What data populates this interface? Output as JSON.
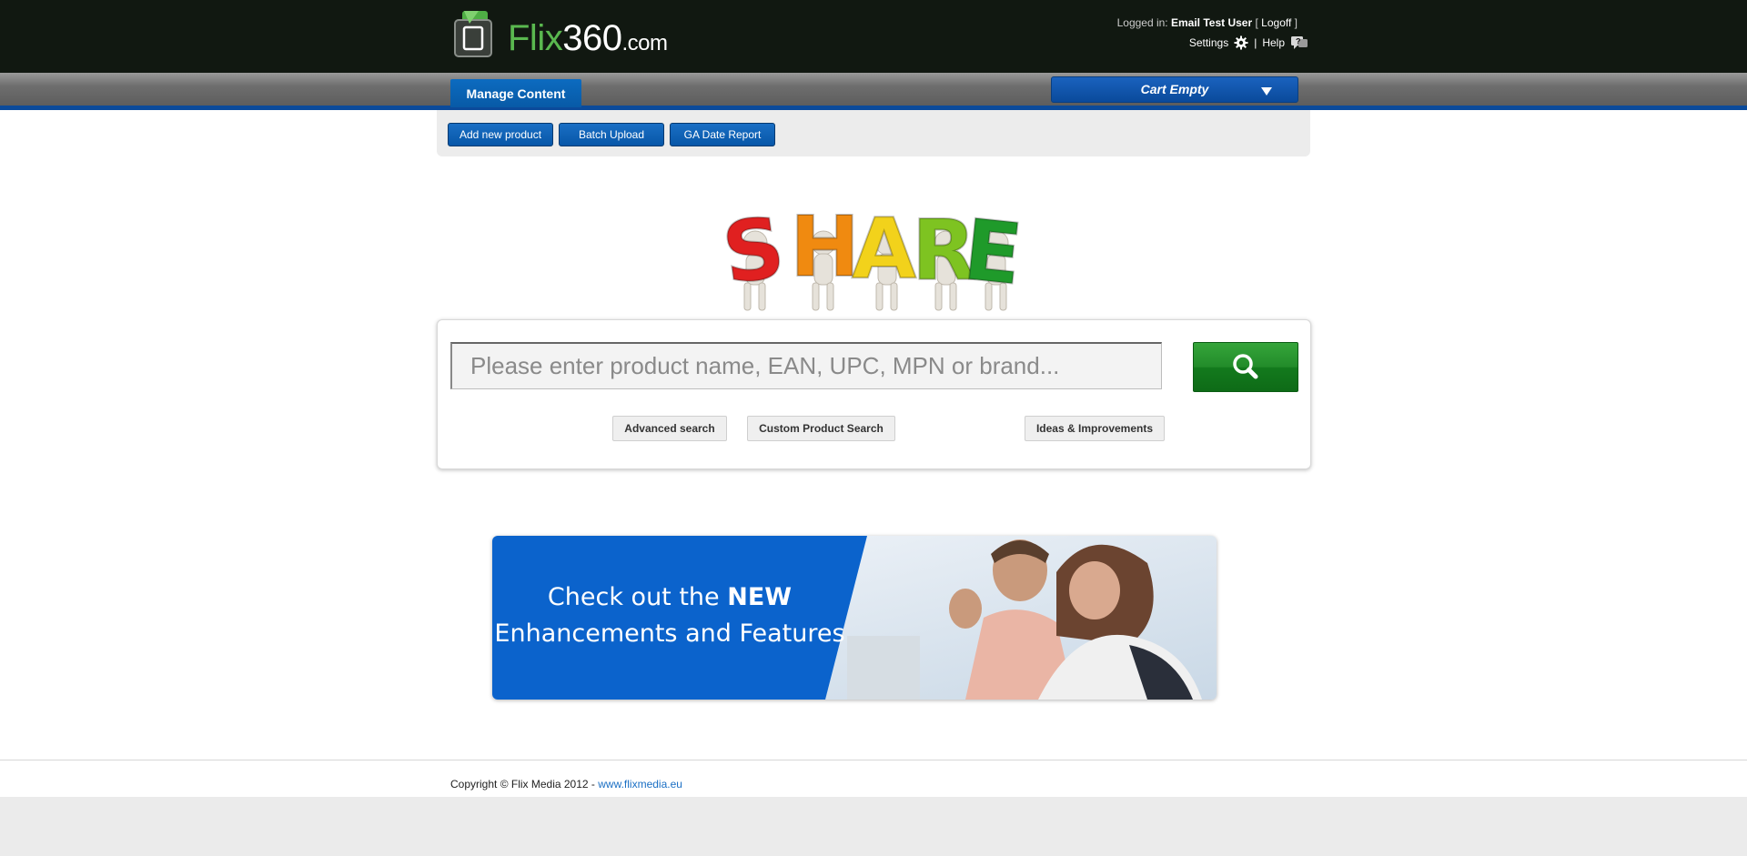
{
  "brand": {
    "logo_flix": "Flix",
    "logo_num": "360",
    "logo_com": ".com"
  },
  "header": {
    "logged_in_label": "Logged in:",
    "user_name": "Email Test User",
    "logoff_label": "Logoff",
    "settings_label": "Settings",
    "help_label": "Help"
  },
  "nav": {
    "tab_label": "Manage Content",
    "cart_label": "Cart Empty"
  },
  "actions": {
    "add_product": "Add new product",
    "batch_upload": "Batch Upload",
    "ga_report": "GA Date Report"
  },
  "hero": {
    "letters": [
      "S",
      "H",
      "A",
      "R",
      "E"
    ],
    "colors": [
      "#e02020",
      "#f08a10",
      "#f2d21b",
      "#7ec321",
      "#1f9a2a"
    ]
  },
  "search": {
    "placeholder": "Please enter product name, EAN, UPC, MPN or brand...",
    "value": "",
    "advanced_label": "Advanced search",
    "custom_label": "Custom Product Search",
    "ideas_label": "Ideas & Improvements"
  },
  "banner": {
    "line1_pre": "Check out the",
    "line1_bold": "NEW",
    "line2": "Enhancements and Features"
  },
  "footer": {
    "copyright": "Copyright © Flix Media 2012 -",
    "link_text": "www.flixmedia.eu"
  },
  "colors": {
    "header_bg": "#111811",
    "accent_blue": "#0b5fb3",
    "search_green": "#1f8f27",
    "brand_green": "#5ab84f"
  }
}
